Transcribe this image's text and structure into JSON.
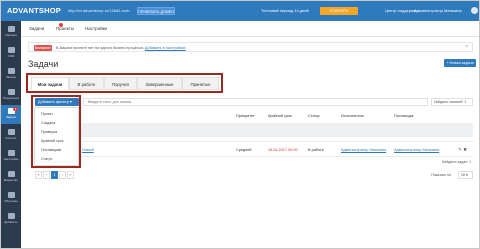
{
  "topbar": {
    "logo": "ADVANTSHOP",
    "site_url": "http://cv.advantshop.ru/13b84-srub",
    "domain_button": "ПРИВЯЗАТЬ ДОМЕН",
    "trial_text": "Тестовый период 14 дней",
    "pay_button": "ОПЛАТИТЬ",
    "support": "Центр поддержки",
    "admin": "Администратор Магазина"
  },
  "sidebar": {
    "items": [
      {
        "label": "Магазин",
        "icon": "store-icon"
      },
      {
        "label": "CRM",
        "icon": "crm-icon"
      },
      {
        "label": "Заказы",
        "icon": "orders-icon"
      },
      {
        "label": "Покупатели",
        "icon": "customers-icon"
      },
      {
        "label": "Задачи",
        "icon": "tasks-icon",
        "badge": "1"
      },
      {
        "label": "Каталог",
        "icon": "catalog-icon"
      },
      {
        "label": "Настройки",
        "icon": "gear-icon"
      },
      {
        "label": "Маркетинг",
        "icon": "marketing-icon"
      },
      {
        "label": "Обучение",
        "icon": "education-icon"
      },
      {
        "label": "Добавить",
        "icon": "add-icon"
      }
    ]
  },
  "subnav": {
    "items": [
      "Задачи",
      "Проекты",
      "Настройки"
    ]
  },
  "alert": {
    "label": "Внимание",
    "text": "В Вашем проекте нет ни одного бизнес процесса.",
    "link": "Добавить в настройках"
  },
  "page": {
    "title": "Задачи",
    "new_task_button": "+ Новая задача"
  },
  "tabs": [
    "Мои задачи",
    "В работе",
    "Поручил",
    "Завершенные",
    "Принятые"
  ],
  "toolbar": {
    "filter_button": "Добавить фильтр ▾",
    "search_placeholder": "Введите текст для поиска",
    "found": "Найдено записей: 1"
  },
  "filter_options": [
    "Проект",
    "Создана",
    "Проверка",
    "Крайний срок",
    "Поставщики",
    "Статус"
  ],
  "table": {
    "headers": [
      "Приоритет",
      "Крайний срок",
      "Статус",
      "Исполнитель",
      "Поставщик"
    ],
    "row": {
      "name": "Новый",
      "priority": "Средний",
      "deadline": "15.04.2017 00:00",
      "status": "В работе",
      "assignee": "Администратор Магазина",
      "author": "Администратор Магазина"
    }
  },
  "footer": {
    "found": "Найдено задач: 1",
    "pages": [
      "«",
      "‹",
      "1",
      "›",
      "»"
    ],
    "per_page_label": "Показать по",
    "per_page": "10"
  },
  "colors": {
    "brand_blue": "#2f79bd",
    "sidebar_dark": "#2b3b4d",
    "highlight_red": "#9b2a1e",
    "pay_orange": "#f6a623",
    "deadline_red": "#d0312d"
  }
}
